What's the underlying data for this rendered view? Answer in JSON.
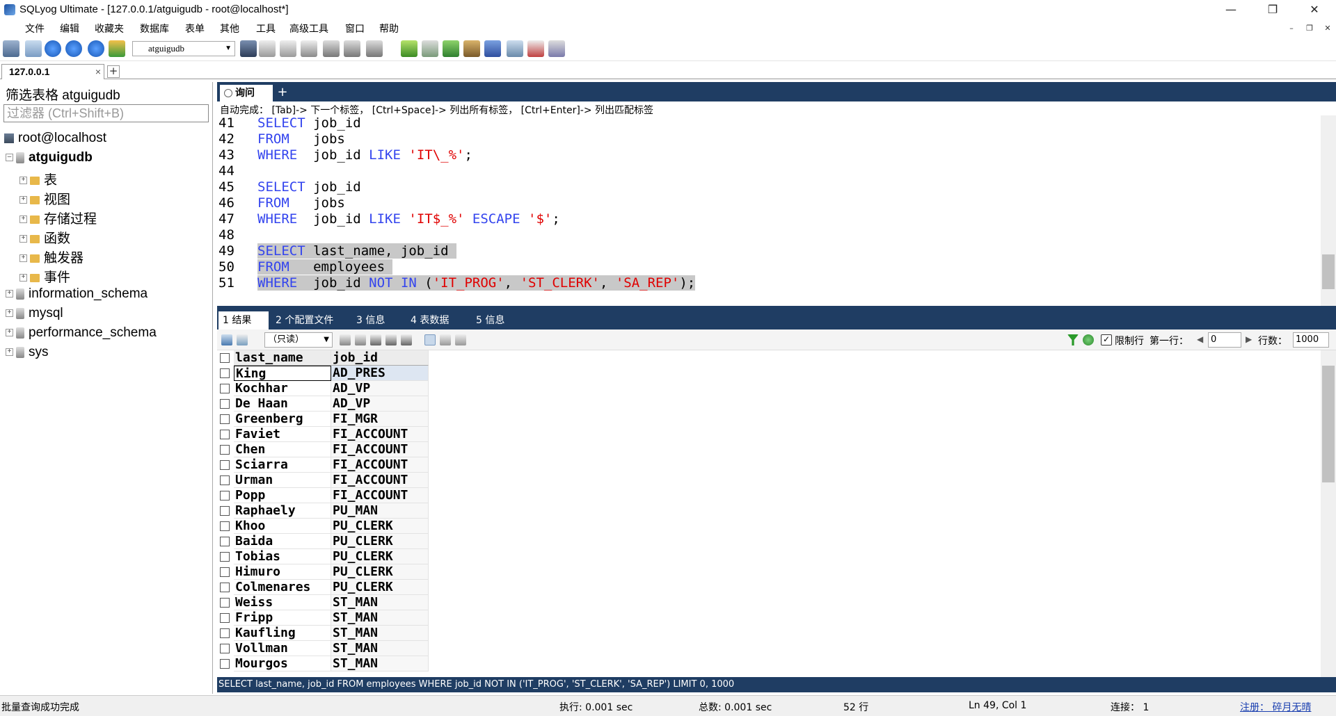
{
  "window": {
    "title": "SQLyog Ultimate - [127.0.0.1/atguigudb - root@localhost*]"
  },
  "menu": [
    "文件",
    "编辑",
    "收藏夹",
    "数据库",
    "表单",
    "其他",
    "工具",
    "高级工具",
    "窗口",
    "帮助"
  ],
  "toolbar": {
    "db_select": "atguigudb"
  },
  "connection_tab": {
    "label": "127.0.0.1"
  },
  "left": {
    "filter_label": "筛选表格 atguigudb",
    "filter_placeholder": "过滤器 (Ctrl+Shift+B)",
    "root": "root@localhost",
    "active_db": "atguigudb",
    "folders": [
      "表",
      "视图",
      "存储过程",
      "函数",
      "触发器",
      "事件"
    ],
    "other_dbs": [
      "information_schema",
      "mysql",
      "performance_schema",
      "sys"
    ]
  },
  "query_tab": {
    "label": "询问"
  },
  "autocomplete_hint": "自动完成：  [Tab]-> 下一个标签，  [Ctrl+Space]-> 列出所有标签，  [Ctrl+Enter]-> 列出匹配标签",
  "code_lines": [
    {
      "n": "41",
      "t": [
        [
          "kw",
          "SELECT"
        ],
        [
          "pn",
          " job_id"
        ]
      ]
    },
    {
      "n": "42",
      "t": [
        [
          "kw",
          "FROM"
        ],
        [
          "pn",
          "   jobs"
        ]
      ]
    },
    {
      "n": "43",
      "t": [
        [
          "kw",
          "WHERE"
        ],
        [
          "pn",
          "  job_id "
        ],
        [
          "kw",
          "LIKE"
        ],
        [
          "pn",
          " "
        ],
        [
          "st",
          "'IT\\_%'"
        ],
        [
          "pn",
          ";"
        ]
      ]
    },
    {
      "n": "44",
      "t": []
    },
    {
      "n": "45",
      "t": [
        [
          "kw",
          "SELECT"
        ],
        [
          "pn",
          " job_id"
        ]
      ]
    },
    {
      "n": "46",
      "t": [
        [
          "kw",
          "FROM"
        ],
        [
          "pn",
          "   jobs"
        ]
      ]
    },
    {
      "n": "47",
      "t": [
        [
          "kw",
          "WHERE"
        ],
        [
          "pn",
          "  job_id "
        ],
        [
          "kw",
          "LIKE"
        ],
        [
          "pn",
          " "
        ],
        [
          "st",
          "'IT$_%'"
        ],
        [
          "pn",
          " "
        ],
        [
          "kw",
          "ESCAPE"
        ],
        [
          "pn",
          " "
        ],
        [
          "st",
          "'$'"
        ],
        [
          "pn",
          ";"
        ]
      ]
    },
    {
      "n": "48",
      "t": []
    },
    {
      "n": "49",
      "hl": true,
      "t": [
        [
          "kw",
          "SELECT"
        ],
        [
          "pn",
          " last_name, job_id "
        ]
      ]
    },
    {
      "n": "50",
      "hl": true,
      "t": [
        [
          "kw",
          "FROM"
        ],
        [
          "pn",
          "   employees "
        ]
      ]
    },
    {
      "n": "51",
      "hl": true,
      "t": [
        [
          "kw",
          "WHERE"
        ],
        [
          "pn",
          "  job_id "
        ],
        [
          "kw",
          "NOT"
        ],
        [
          "pn",
          " "
        ],
        [
          "kw",
          "IN"
        ],
        [
          "pn",
          " ("
        ],
        [
          "st",
          "'IT_PROG'"
        ],
        [
          "pn",
          ", "
        ],
        [
          "st",
          "'ST_CLERK'"
        ],
        [
          "pn",
          ", "
        ],
        [
          "st",
          "'SA_REP'"
        ],
        [
          "pn",
          ");"
        ]
      ]
    }
  ],
  "result_tabs": [
    "1 结果",
    "2 个配置文件",
    "3 信息",
    "4 表数据",
    "5 信息"
  ],
  "result_toolbar": {
    "readonly": "（只读）",
    "limit_label": "限制行",
    "first_row_label": "第一行：",
    "first_row": "0",
    "rows_label": "行数：",
    "rows": "1000"
  },
  "grid": {
    "columns": [
      "last_name",
      "job_id"
    ],
    "rows": [
      [
        "King",
        "AD_PRES"
      ],
      [
        "Kochhar",
        "AD_VP"
      ],
      [
        "De Haan",
        "AD_VP"
      ],
      [
        "Greenberg",
        "FI_MGR"
      ],
      [
        "Faviet",
        "FI_ACCOUNT"
      ],
      [
        "Chen",
        "FI_ACCOUNT"
      ],
      [
        "Sciarra",
        "FI_ACCOUNT"
      ],
      [
        "Urman",
        "FI_ACCOUNT"
      ],
      [
        "Popp",
        "FI_ACCOUNT"
      ],
      [
        "Raphaely",
        "PU_MAN"
      ],
      [
        "Khoo",
        "PU_CLERK"
      ],
      [
        "Baida",
        "PU_CLERK"
      ],
      [
        "Tobias",
        "PU_CLERK"
      ],
      [
        "Himuro",
        "PU_CLERK"
      ],
      [
        "Colmenares",
        "PU_CLERK"
      ],
      [
        "Weiss",
        "ST_MAN"
      ],
      [
        "Fripp",
        "ST_MAN"
      ],
      [
        "Kaufling",
        "ST_MAN"
      ],
      [
        "Vollman",
        "ST_MAN"
      ],
      [
        "Mourgos",
        "ST_MAN"
      ]
    ]
  },
  "sql_status": "SELECT last_name, job_id FROM employees WHERE job_id NOT IN ('IT_PROG', 'ST_CLERK', 'SA_REP') LIMIT 0, 1000",
  "statusbar": {
    "msg": "批量查询成功完成",
    "exec": "执行: 0.001 sec",
    "total": "总数: 0.001 sec",
    "rows": "52 行",
    "pos": "Ln 49, Col 1",
    "conn": "连接： 1",
    "reg": "注册： 碎月无晴"
  }
}
